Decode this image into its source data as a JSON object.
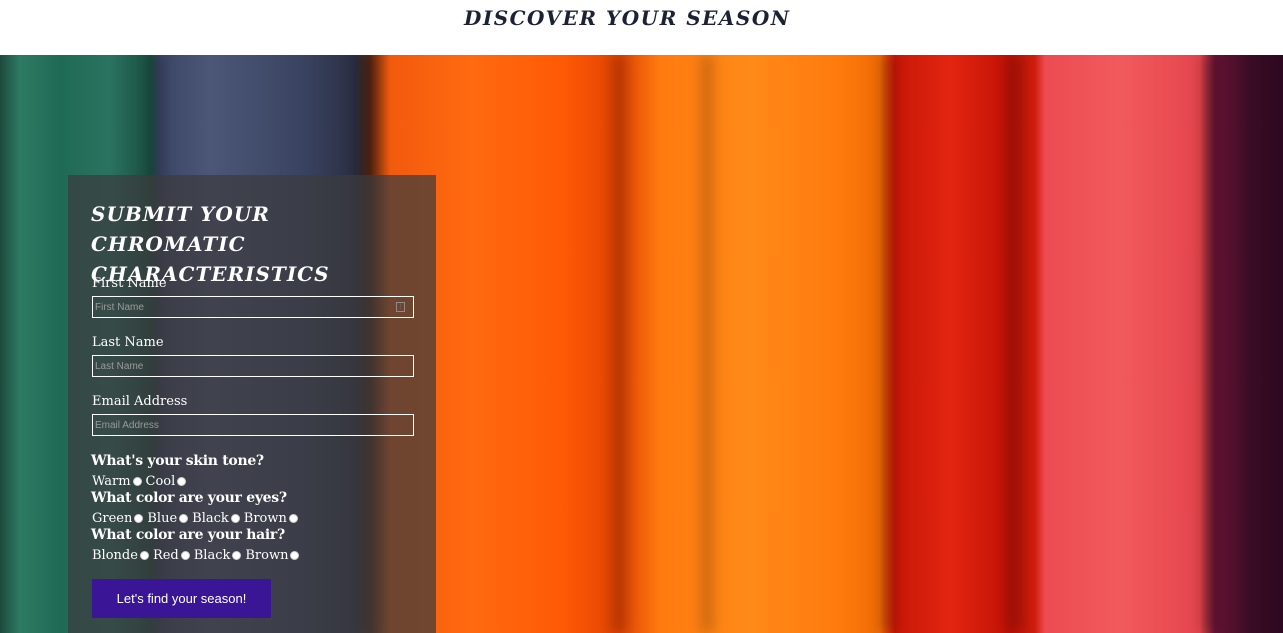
{
  "header": {
    "title": "DISCOVER YOUR SEASON"
  },
  "form": {
    "heading": "SUBMIT YOUR CHROMATIC CHARACTERISTICS",
    "first_name": {
      "label": "First Name",
      "placeholder": "First Name",
      "value": ""
    },
    "last_name": {
      "label": "Last Name",
      "placeholder": "Last Name",
      "value": ""
    },
    "email": {
      "label": "Email Address",
      "placeholder": "Email Address",
      "value": ""
    },
    "skin": {
      "question": "What's your skin tone?",
      "options": [
        "Warm",
        "Cool"
      ]
    },
    "eyes": {
      "question": "What color are your eyes?",
      "options": [
        "Green",
        "Blue",
        "Black",
        "Brown"
      ]
    },
    "hair": {
      "question": "What color are your hair?",
      "options": [
        "Blonde",
        "Red",
        "Black",
        "Brown"
      ]
    },
    "submit_label": "Let's find your season!"
  },
  "colors": {
    "submit_button": "#3a1596",
    "title_text": "#1c2134"
  }
}
